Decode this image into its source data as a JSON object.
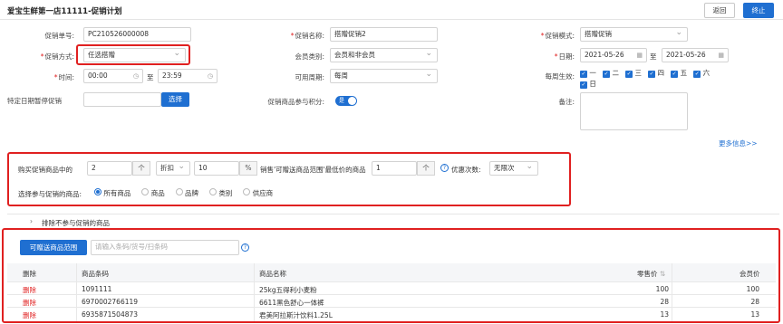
{
  "header": {
    "title": "爱宝生鲜第一店11111-促销计划",
    "back": "返回",
    "stop": "终止"
  },
  "form": {
    "promo_no_label": "促销单号:",
    "promo_no": "PC210526000008",
    "promo_name_label": "促销名称:",
    "promo_name": "搭赠促销2",
    "promo_mode_label": "促销模式:",
    "promo_mode": "搭赠促销",
    "promo_type_label": "促销方式:",
    "promo_type": "任选搭赠",
    "member_label": "会员类别:",
    "member": "会员和非会员",
    "date_label": "日期:",
    "date_from": "2021-05-26",
    "date_to_label": "至",
    "date_to": "2021-05-26",
    "time_label": "时间:",
    "time_from": "00:00",
    "time_to_label": "至",
    "time_to": "23:59",
    "cycle_label": "可用周期:",
    "cycle": "每周",
    "weekday_label": "每周生效:",
    "weekdays": [
      "一",
      "二",
      "三",
      "四",
      "五",
      "六",
      "日"
    ],
    "pause_label": "特定日期暂停促销",
    "pause_btn": "选择",
    "points_label": "促销商品参与积分:",
    "points_toggle": "是",
    "remark_label": "备注:",
    "more": "更多信息>>"
  },
  "rule": {
    "buy_label": "购买促销商品中的",
    "buy_qty": "2",
    "buy_unit": "个",
    "discount_type": "折扣",
    "discount_value": "10",
    "discount_unit": "%",
    "give_label": "销售'可赠送商品范围'最低价的商品",
    "give_qty": "1",
    "give_unit": "个",
    "limit_label": "优惠次数:",
    "limit_value": "无限次",
    "scope_label": "选择参与促销的商品:",
    "scope_options": [
      "所有商品",
      "商品",
      "品牌",
      "类别",
      "供应商"
    ]
  },
  "exclude": {
    "label": "排除不参与促销的商品"
  },
  "gift": {
    "range_btn": "可赠送商品范围",
    "search_placeholder": "请输入条码/货号/扫条码",
    "columns": [
      "删除",
      "商品条码",
      "商品名称",
      "零售价",
      "会员价"
    ],
    "rows": [
      {
        "del": "删除",
        "code": "1091111",
        "name": "25kg五得利小麦粉",
        "price": "100",
        "member": "100"
      },
      {
        "del": "删除",
        "code": "6970002766119",
        "name": "6611黑色舒心一体裤",
        "price": "28",
        "member": "28"
      },
      {
        "del": "删除",
        "code": "6935871504873",
        "name": "君美阿拉斯汁饮料1.25L",
        "price": "13",
        "member": "13"
      }
    ]
  },
  "colors": {
    "accent": "#1f6fd1",
    "highlight": "#e02020"
  }
}
